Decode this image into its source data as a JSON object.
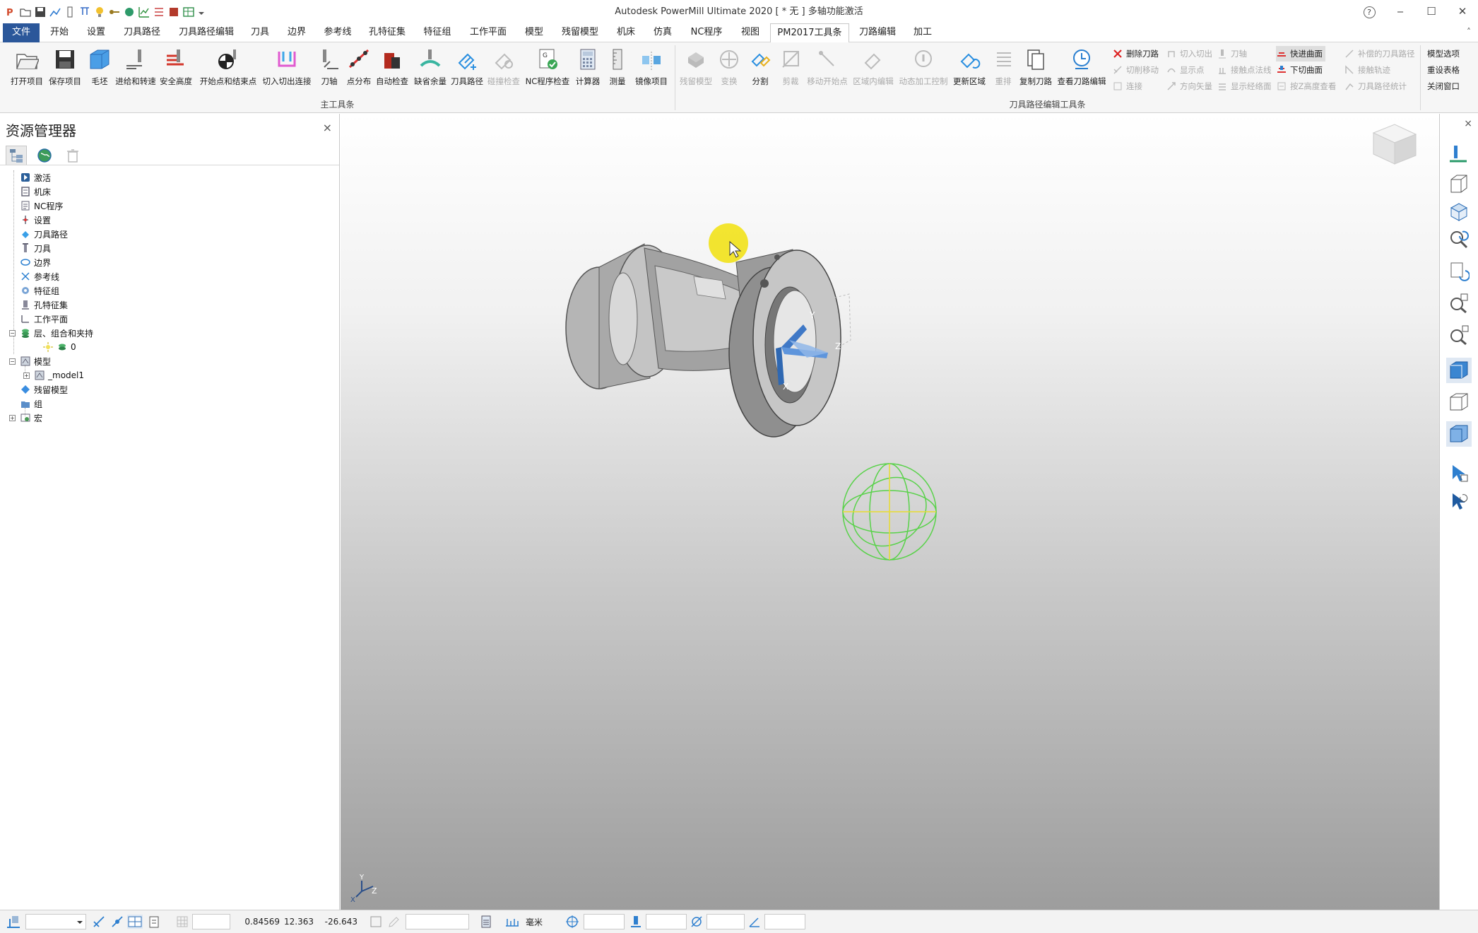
{
  "window": {
    "title": "Autodesk PowerMill Ultimate 2020   [ * 无 ]   多轴功能激活",
    "help": "?",
    "minimize": "‒",
    "maximize": "☐",
    "close": "✕"
  },
  "menu": {
    "tabs": [
      "文件",
      "开始",
      "设置",
      "刀具路径",
      "刀具路径编辑",
      "刀具",
      "边界",
      "参考线",
      "孔特征集",
      "特征组",
      "工作平面",
      "模型",
      "残留模型",
      "机床",
      "仿真",
      "NC程序",
      "视图",
      "PM2017工具条",
      "刀路编辑",
      "加工"
    ],
    "active": "PM2017工具条",
    "collapse": "˄"
  },
  "ribbon": {
    "main_group_label": "主工具条",
    "edit_group_label": "刀具路径编辑工具条",
    "main_buttons": [
      "打开项目",
      "保存项目",
      "毛坯",
      "进给和转速",
      "安全高度",
      "开始点和结束点",
      "切入切出连接",
      "刀轴",
      "点分布",
      "自动检查",
      "缺省余量",
      "刀具路径",
      "碰撞检查",
      "NC程序检查",
      "计算器",
      "测量",
      "镜像项目"
    ],
    "edit_buttons": [
      "残留模型",
      "变换",
      "分割",
      "剪裁",
      "移动开始点",
      "区域内编辑",
      "动态加工控制",
      "更新区域",
      "重排",
      "复制刀路",
      "查看刀路编辑"
    ],
    "small_col1": [
      "删除刀路",
      "切削移动",
      "连接"
    ],
    "small_col2": [
      "切入切出",
      "显示点",
      "方向矢量"
    ],
    "small_col3": [
      "刀轴",
      "接触点法线",
      "显示经络面"
    ],
    "small_col4": [
      "快进曲面",
      "下切曲面",
      "按Z高度查看"
    ],
    "small_col5": [
      "补偿的刀具路径",
      "接触轨迹",
      "刀具路径统计"
    ],
    "right_links": [
      "模型选项",
      "重设表格",
      "关闭窗口"
    ]
  },
  "explorer": {
    "title": "资源管理器",
    "close": "×",
    "tree": [
      {
        "label": "激活"
      },
      {
        "label": "机床"
      },
      {
        "label": "NC程序"
      },
      {
        "label": "设置"
      },
      {
        "label": "刀具路径"
      },
      {
        "label": "刀具"
      },
      {
        "label": "边界"
      },
      {
        "label": "参考线"
      },
      {
        "label": "特征组"
      },
      {
        "label": "孔特征集"
      },
      {
        "label": "工作平面"
      },
      {
        "label": "层、组合和夹持"
      },
      {
        "label": "0"
      },
      {
        "label": "模型"
      },
      {
        "label": "_model1"
      },
      {
        "label": "残留模型"
      },
      {
        "label": "组"
      },
      {
        "label": "宏"
      }
    ]
  },
  "viewport": {
    "axis_y": "Y",
    "axis_z": "Z",
    "axis_x": "X",
    "corner_y": "Y",
    "corner_z": "Z",
    "corner_x": "X"
  },
  "status": {
    "coord_x": "0.84569",
    "coord_y": "12.363",
    "coord_z": "-26.643",
    "units": "毫米"
  },
  "colors": {
    "file_tab": "#2b579a",
    "workplane_blue": "#4a7fc1",
    "sphere_green": "#59d24a",
    "cursor_highlight": "#f2e21a"
  }
}
